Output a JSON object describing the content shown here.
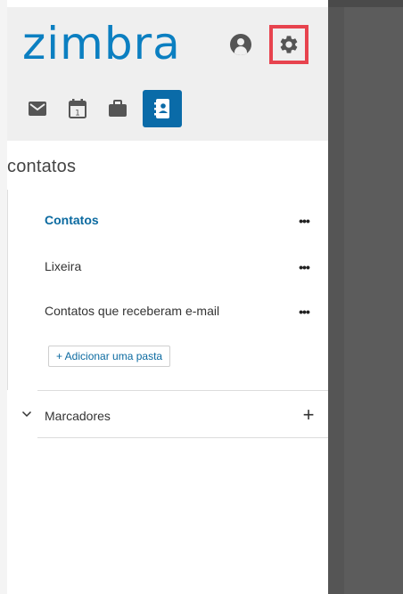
{
  "app": {
    "logo_text": "zimbra",
    "brand_color": "#0b7fc1",
    "icons": {
      "account": "user-circle-icon",
      "settings": "gear-icon"
    },
    "highlight_color": "#e7434e"
  },
  "app_tabs": [
    {
      "icon": "mail-icon"
    },
    {
      "icon": "calendar-icon",
      "day": "1"
    },
    {
      "icon": "briefcase-icon"
    },
    {
      "icon": "address-book-icon",
      "active": true
    }
  ],
  "section": {
    "title": "contatos"
  },
  "folders": [
    {
      "label": "Contatos",
      "active": true,
      "more": "•••"
    },
    {
      "label": "Lixeira",
      "more": "•••"
    },
    {
      "label": "Contatos que receberam e-mail",
      "more": "•••"
    }
  ],
  "add_folder_label": "+ Adicionar uma pasta",
  "tags": {
    "label": "Marcadores",
    "add": "+"
  },
  "overlay_color": "#5c5c5c"
}
